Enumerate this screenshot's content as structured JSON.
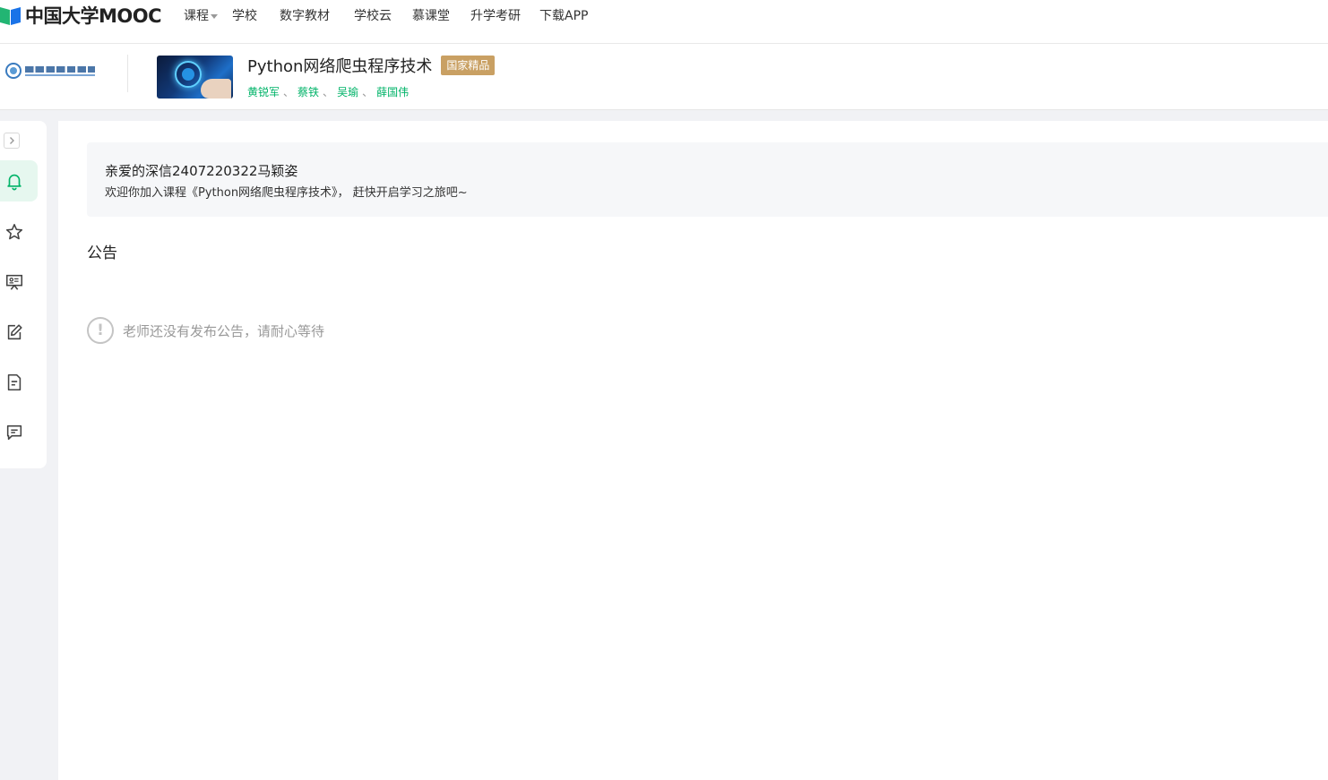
{
  "brand": {
    "logo_text": "中国大学MOOC",
    "colors": {
      "logo_blue": "#1a73e8",
      "logo_green": "#22b573",
      "accent_green": "#00b368",
      "badge_gold": "#c9a063"
    }
  },
  "nav": {
    "items": [
      {
        "label": "课程",
        "has_caret": true
      },
      {
        "label": "学校"
      },
      {
        "label": "数字教材"
      },
      {
        "label": "学校云"
      },
      {
        "label": "慕课堂"
      },
      {
        "label": "升学考研"
      },
      {
        "label": "下载APP"
      }
    ]
  },
  "course": {
    "title": "Python网络爬虫程序技术",
    "badge": "国家精品",
    "teachers": [
      "黄锐军",
      "蔡铁",
      "吴瑜",
      "薛国伟"
    ],
    "teacher_separator": "、"
  },
  "sidebar": {
    "items": [
      {
        "icon": "bell-icon",
        "active": true
      },
      {
        "icon": "star-icon"
      },
      {
        "icon": "presentation-icon"
      },
      {
        "icon": "edit-icon"
      },
      {
        "icon": "document-icon"
      },
      {
        "icon": "comment-icon"
      }
    ]
  },
  "welcome": {
    "name_line": "亲爱的深信2407220322马颖姿",
    "message": "欢迎你加入课程《Python网络爬虫程序技术》， 赶快开启学习之旅吧~"
  },
  "announcements": {
    "title": "公告",
    "empty_icon": "!",
    "empty_text": "老师还没有发布公告，请耐心等待"
  }
}
